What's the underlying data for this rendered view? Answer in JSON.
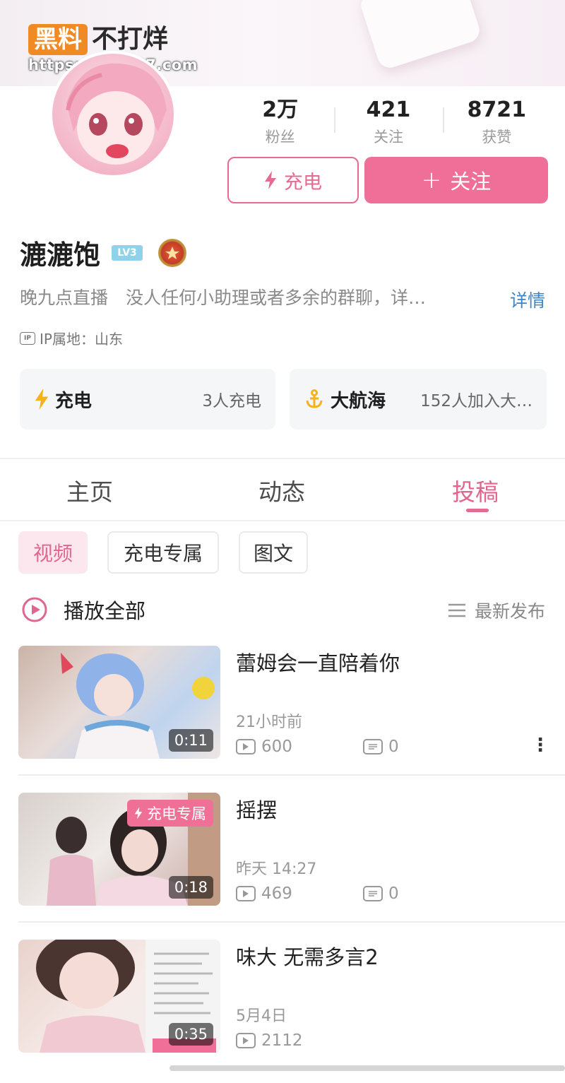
{
  "watermark": {
    "brand": "黑料",
    "rest": "不打烊",
    "url": "https://bbdy27.com"
  },
  "stats": [
    {
      "value": "2万",
      "label": "粉丝"
    },
    {
      "value": "421",
      "label": "关注"
    },
    {
      "value": "8721",
      "label": "获赞"
    }
  ],
  "buttons": {
    "charge": "充电",
    "follow": "关注"
  },
  "profile": {
    "name": "漉漉饱",
    "level": "LV3",
    "bio": "晚九点直播　没人任何小助理或者多余的群聊，详…",
    "bio_more": "详情",
    "ip": "IP属地：山东"
  },
  "cards": {
    "charge": {
      "title": "充电",
      "sub": "3人充电"
    },
    "fleet": {
      "title": "大航海",
      "sub": "152人加入大…"
    }
  },
  "tabs": [
    {
      "label": "主页"
    },
    {
      "label": "动态"
    },
    {
      "label": "投稿"
    }
  ],
  "chips": {
    "video": "视频",
    "charge_exclusive": "充电专属",
    "image_text": "图文"
  },
  "list_controls": {
    "play_all": "播放全部",
    "sort": "最新发布"
  },
  "videos": [
    {
      "title": "蕾姆会一直陪着你",
      "time": "21小时前",
      "views": "600",
      "comments": "0",
      "duration": "0:11",
      "badge": ""
    },
    {
      "title": "摇摆",
      "time": "昨天 14:27",
      "views": "469",
      "comments": "0",
      "duration": "0:18",
      "badge": "充电专属"
    },
    {
      "title": "味大 无需多言2",
      "time": "5月4日",
      "views": "2112",
      "comments": "",
      "duration": "0:35",
      "badge": ""
    }
  ],
  "colors": {
    "accent": "#ef6f98",
    "link": "#3b85c9"
  }
}
